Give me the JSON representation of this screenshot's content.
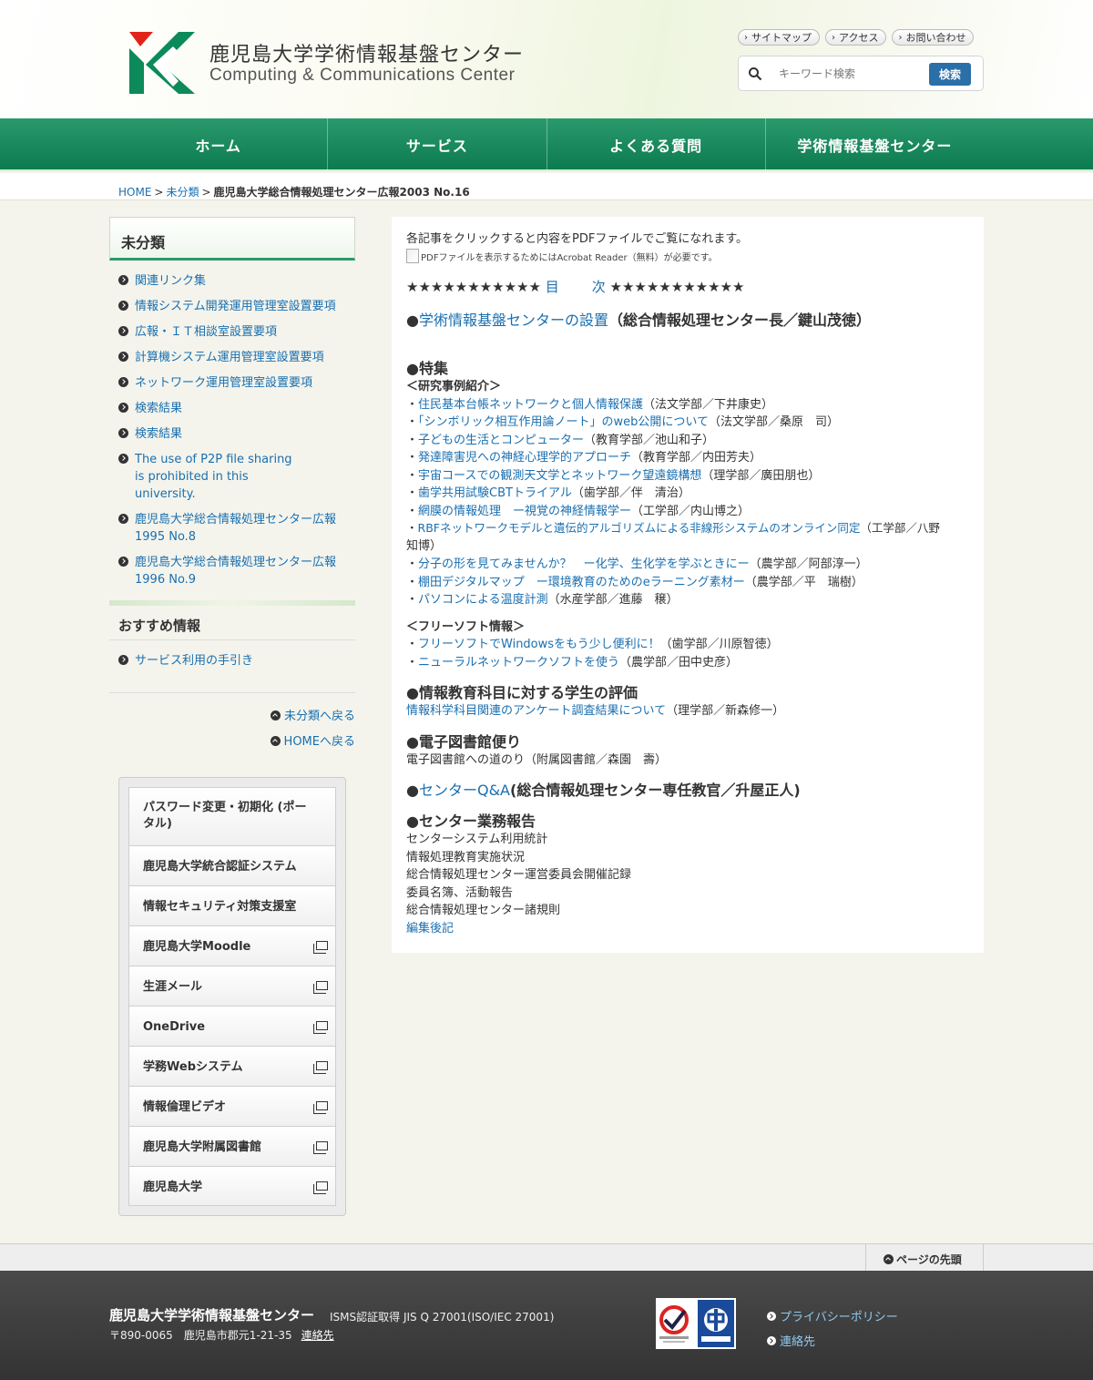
{
  "header": {
    "title": "鹿児島大学学術情報基盤センター",
    "subtitle": "Computing & Communications Center",
    "util_links": [
      "サイトマップ",
      "アクセス",
      "お問い合わせ"
    ],
    "search": {
      "placeholder": "キーワード検索",
      "button": "検索"
    }
  },
  "nav": [
    "ホーム",
    "サービス",
    "よくある質問",
    "学術情報基盤センター"
  ],
  "breadcrumb": {
    "home": "HOME",
    "category": "未分類",
    "current": "鹿児島大学総合情報処理センター広報2003 No.16"
  },
  "sidebar": {
    "category_title": "未分類",
    "category_items": [
      "関連リンク集",
      "情報システム開発運用管理室設置要項",
      "広報・ＩＴ相談室設置要項",
      "計算機システム運用管理室設置要項",
      "ネットワーク運用管理室設置要項",
      "検索結果",
      "検索結果",
      "The use of P2P file sharing is prohibited in this university.",
      "鹿児島大学総合情報処理センター広報1995 No.8",
      "鹿児島大学総合情報処理センター広報1996 No.9"
    ],
    "recommend_title": "おすすめ情報",
    "recommend_items": [
      "サービス利用の手引き"
    ],
    "back_category": "未分類へ戻る",
    "back_home": "HOMEへ戻る",
    "banners": [
      "パスワード変更・初期化 (ポータル)",
      "鹿児島大学統合認証システム",
      "情報セキュリティ対策支援室",
      "鹿児島大学Moodle",
      "生涯メール",
      "OneDrive",
      "学務Webシステム",
      "情報倫理ビデオ",
      "鹿児島大学附属図書館",
      "鹿児島大学"
    ]
  },
  "main": {
    "intro": "各記事をクリックすると内容をPDFファイルでご覧になれます。",
    "pdf_note": "PDFファイルを表示するためにはAcrobat Reader（無料）が必要です。",
    "toc_stars_left": "★★★★★★★★★★★",
    "toc_left_link": "目",
    "toc_right_link": "次",
    "toc_stars_right": "★★★★★★★★★★★",
    "sec1": {
      "bullet": "●",
      "link": "学術情報基盤センターの設置",
      "author": "（総合情報処理センター長／鍵山茂徳）"
    },
    "sec2": {
      "title": "●特集",
      "sub1": "＜研究事例紹介＞",
      "items1": [
        {
          "link": "住民基本台帳ネットワークと個人情報保護",
          "author": "（法文学部／下井康史）"
        },
        {
          "link": "「シンボリック相互作用論ノート」のweb公開について",
          "author": "（法文学部／桑原　司）"
        },
        {
          "link": "子どもの生活とコンピューター",
          "author": "（教育学部／池山和子）"
        },
        {
          "link": "発達障害児への神経心理学的アプローチ",
          "author": "（教育学部／内田芳夫）"
        },
        {
          "link": "宇宙コースでの観測天文学とネットワーク望遠鏡構想",
          "author": "（理学部／廣田朋也）"
        },
        {
          "link": "歯学共用試験CBTトライアル",
          "author": "（歯学部／伴　清治）"
        },
        {
          "link": "網膜の情報処理　ー視覚の神経情報学ー",
          "author": "（工学部／内山博之）"
        },
        {
          "link": "RBFネットワークモデルと遺伝的アルゴリズムによる非線形システムのオンライン同定",
          "author": "（工学部／八野",
          "author_cont": "知博）"
        },
        {
          "link": "分子の形を見てみませんか？　ー化学、生化学を学ぶときにー",
          "author": "（農学部／阿部淳一）"
        },
        {
          "link": "棚田デジタルマップ　ー環境教育のためのeラーニング素材ー",
          "author": "（農学部／平　瑞樹）"
        },
        {
          "link": "パソコンによる温度計測",
          "author": "（水産学部／進藤　穣）"
        }
      ],
      "sub2": "＜フリーソフト情報＞",
      "items2": [
        {
          "link": "フリーソフトでWindowsをもう少し便利に！",
          "author": "（歯学部／川原智徳）"
        },
        {
          "link": "ニューラルネットワークソフトを使う",
          "author": "（農学部／田中史彦）"
        }
      ]
    },
    "sec3": {
      "title": "●情報教育科目に対する学生の評価",
      "link": "情報科学科目関連のアンケート調査結果について",
      "author": "（理学部／新森修一）"
    },
    "sec4": {
      "title": "●電子図書館便り",
      "text": "電子図書館への道のり（附属図書館／森園　壽）"
    },
    "sec5": {
      "bullet": "●",
      "link": "センターQ&A",
      "author": "(総合情報処理センター専任教官／升屋正人)"
    },
    "sec6": {
      "title": "●センター業務報告",
      "items": [
        "センターシステム利用統計",
        "情報処理教育実施状況",
        "総合情報処理センター運営委員会開催記録",
        "委員名簿、活動報告",
        "総合情報処理センター諸規則"
      ],
      "last_link": "編集後記"
    },
    "item_prefix": "・"
  },
  "footer": {
    "page_top": "ページの先頭",
    "name": "鹿児島大学学術情報基盤センター",
    "isms": "ISMS認証取得 JIS Q 27001(ISO/IEC 27001)",
    "address": "〒890-0065　鹿児島市郡元1-21-35",
    "contact": "連絡先",
    "links": [
      "プライバシーポリシー",
      "連絡先"
    ]
  },
  "colors": {
    "brand_green": "#0c7b4f",
    "logo_red": "#e2231a",
    "link_blue": "#1a6fb0",
    "search_button": "#2b6fa8"
  }
}
